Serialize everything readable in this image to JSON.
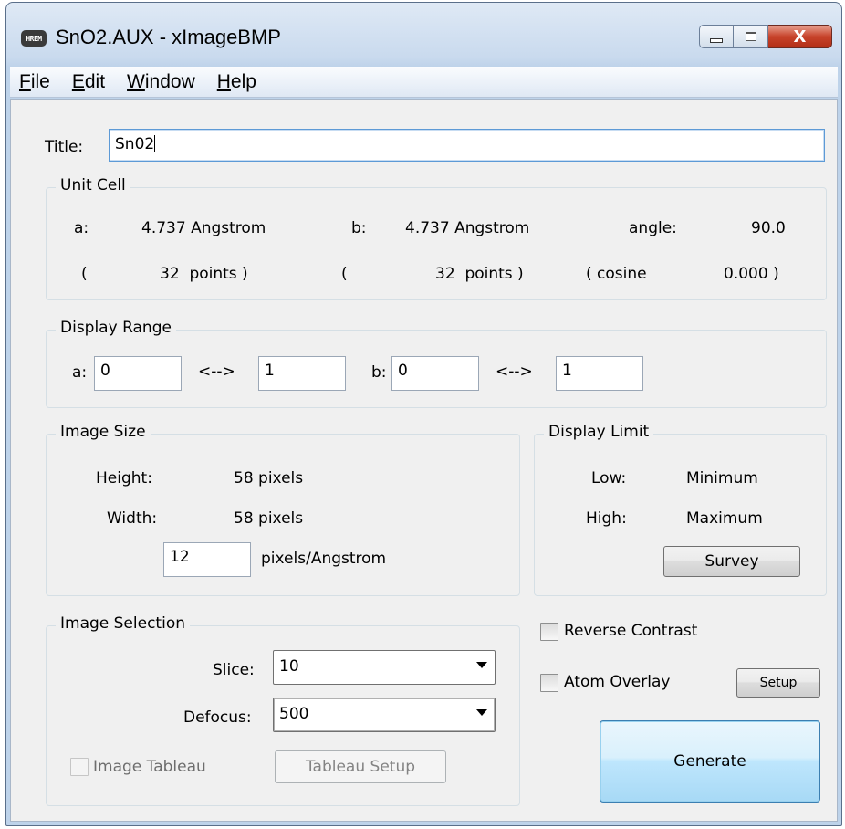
{
  "window": {
    "app_icon": "HREM",
    "title": "SnO2.AUX - xImageBMP",
    "close_glyph": "X"
  },
  "menu": [
    "File",
    "Edit",
    "Window",
    "Help"
  ],
  "menu_mnemonics": [
    [
      "F",
      "ile"
    ],
    [
      "E",
      "dit"
    ],
    [
      "W",
      "indow"
    ],
    [
      "H",
      "elp"
    ]
  ],
  "title_field": {
    "label": "Title:",
    "value": "Sn02"
  },
  "unit_cell": {
    "group_label": "Unit Cell",
    "a_label": "a:",
    "a_value": "4.737 Angstrom",
    "b_label": "b:",
    "b_value": "4.737 Angstrom",
    "angle_label": "angle:",
    "angle_value": "90.0",
    "a_open": "(",
    "a_points": "32  points )",
    "b_open": "(",
    "b_points": "32  points )",
    "cos_label": "( cosine",
    "cos_value": "0.000 )"
  },
  "display_range": {
    "group_label": "Display Range",
    "a_label": "a:",
    "a_from": "0",
    "arrow": "<-->",
    "a_to": "1",
    "b_label": "b:",
    "b_from": "0",
    "b_to": "1"
  },
  "image_size": {
    "group_label": "Image Size",
    "height_label": "Height:",
    "height_value": "58 pixels",
    "width_label": "Width:",
    "width_value": "58 pixels",
    "ppa_value": "12",
    "ppa_unit": "pixels/Angstrom"
  },
  "display_limit": {
    "group_label": "Display Limit",
    "low_label": "Low:",
    "low_value": "Minimum",
    "high_label": "High:",
    "high_value": "Maximum",
    "survey_button": "Survey"
  },
  "image_selection": {
    "group_label": "Image Selection",
    "slice_label": "Slice:",
    "slice_value": "10",
    "defocus_label": "Defocus:",
    "defocus_value": "500",
    "tableau_label": "Image Tableau",
    "tableau_setup_button": "Tableau Setup"
  },
  "options": {
    "reverse_contrast": "Reverse Contrast",
    "atom_overlay": "Atom Overlay",
    "setup_button": "Setup",
    "generate_button": "Generate"
  }
}
